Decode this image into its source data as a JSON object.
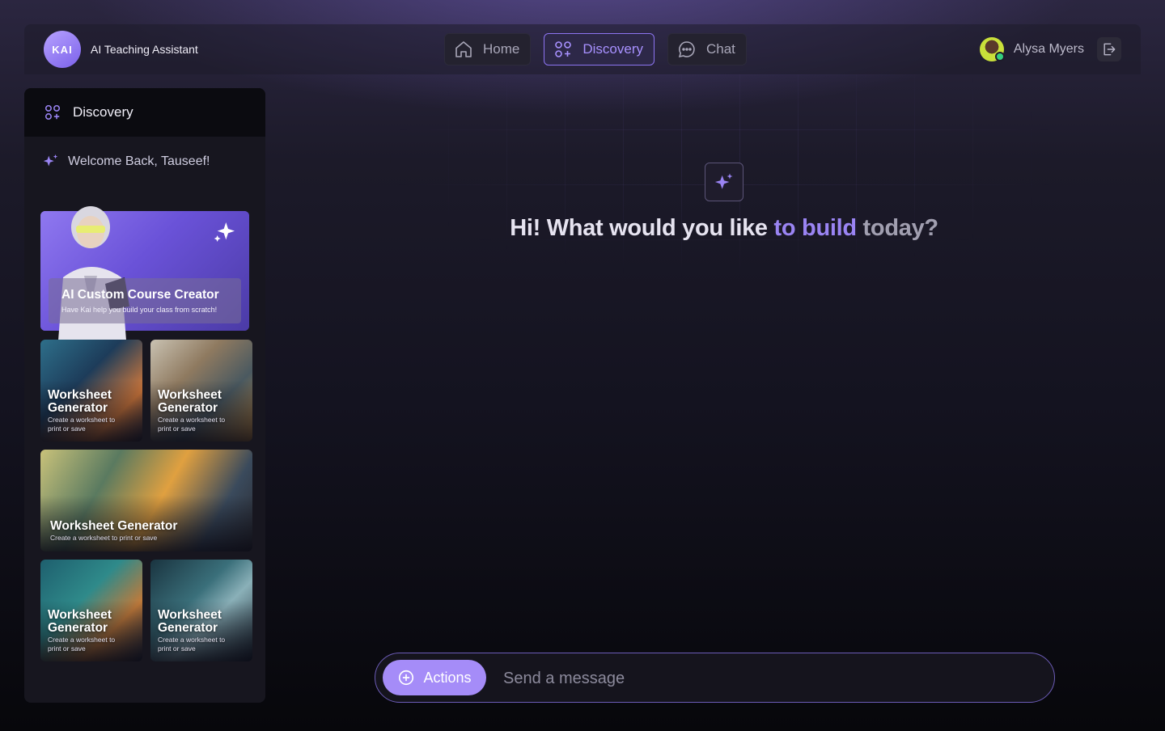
{
  "brand": {
    "logo_text": "KAI",
    "name": "AI Teaching Assistant"
  },
  "nav": {
    "items": [
      {
        "label": "Home",
        "icon": "home-icon"
      },
      {
        "label": "Discovery",
        "icon": "grid-icon",
        "active": true
      },
      {
        "label": "Chat",
        "icon": "chat-bubble-icon"
      }
    ]
  },
  "user": {
    "name": "Alysa Myers",
    "status": "online"
  },
  "sidebar": {
    "header": "Discovery",
    "welcome": "Welcome Back, Tauseef!",
    "featured": {
      "title": "AI Custom Course Creator",
      "subtitle": "Have Kai help you build your class from scratch!"
    },
    "cards": [
      {
        "title": "Worksheet Generator",
        "subtitle": "Create a worksheet to print or save"
      },
      {
        "title": "Worksheet Generator",
        "subtitle": "Create a worksheet to print or save"
      },
      {
        "title": "Worksheet Generator",
        "subtitle": "Create a worksheet to print or save"
      },
      {
        "title": "Worksheet Generator",
        "subtitle": "Create a worksheet to print or save"
      },
      {
        "title": "Worksheet Generator",
        "subtitle": "Create a worksheet to print or save"
      }
    ]
  },
  "main": {
    "headline_a": "Hi! What would you like ",
    "headline_b": "to build",
    "headline_c": " today?"
  },
  "composer": {
    "actions_label": "Actions",
    "placeholder": "Send a message",
    "value": ""
  },
  "colors": {
    "accent": "#9a84f3",
    "accent_button": "#a58cf8",
    "background": "#141320",
    "sidebar": "#17161f"
  }
}
